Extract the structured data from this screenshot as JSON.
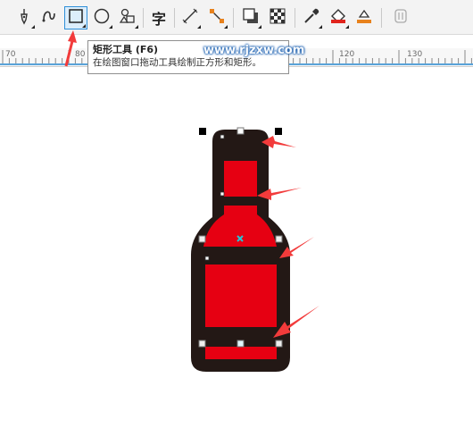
{
  "toolbar": {
    "tools": [
      {
        "name": "pen-tool-icon"
      },
      {
        "name": "freehand-curve-icon"
      },
      {
        "name": "rectangle-tool-icon",
        "active": true
      },
      {
        "name": "ellipse-tool-icon"
      },
      {
        "name": "shapes-tool-icon"
      },
      {
        "name": "text-tool-icon",
        "glyph": "字"
      },
      {
        "name": "parallel-dimension-icon"
      },
      {
        "name": "connector-tool-icon"
      },
      {
        "name": "drop-shadow-icon"
      },
      {
        "name": "transparency-icon"
      },
      {
        "name": "eyedropper-icon"
      },
      {
        "name": "interactive-fill-icon"
      },
      {
        "name": "smart-fill-icon"
      },
      {
        "name": "extra-tool-icon"
      }
    ],
    "accent": "#2e8fd8"
  },
  "ruler": {
    "labels": [
      "70",
      "80",
      "120",
      "130"
    ]
  },
  "tooltip": {
    "title": "矩形工具 (F6)",
    "description": "在绘图窗口拖动工具绘制正方形和矩形。"
  },
  "watermark": "www.rjzxw.com",
  "drawing": {
    "bottle_outline_color": "#231815",
    "fill_color": "#e60012",
    "arrow_color": "#f23b3b",
    "handle_color": "#000000",
    "center_marker_color": "#27c3d6"
  }
}
